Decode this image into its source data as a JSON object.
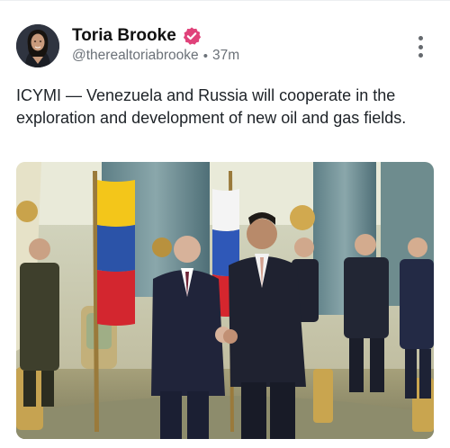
{
  "post": {
    "author_name": "Toria Brooke",
    "handle": "@therealtoriabrooke",
    "separator": "•",
    "time_ago": "37m",
    "text": "ICYMI — Venezuela and Russia will cooperate in the exploration and development of new oil and gas fields.",
    "icons": {
      "verified": "verified-badge-icon",
      "menu": "more-options-icon"
    },
    "colors": {
      "verified_badge": "#e0427a",
      "handle": "#6b7178",
      "text": "#1d2227"
    },
    "media_description_shown": false
  }
}
